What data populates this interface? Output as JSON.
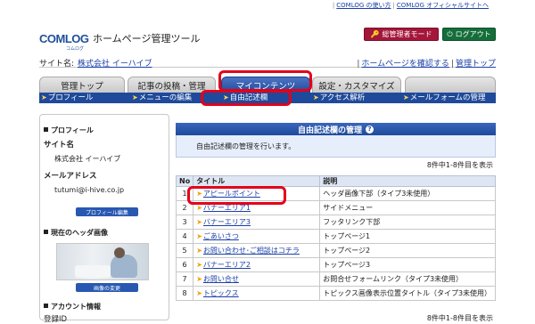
{
  "top_links": [
    "COMLOG の使い方",
    "COMLOG オフィシャルサイトへ"
  ],
  "header": {
    "logo": "COMLOG",
    "logo_sub": "コムログ",
    "title": "ホームページ管理ツール",
    "admin_button": "総管理者モード",
    "logout_button": "ログアウト"
  },
  "site_bar": {
    "label": "サイト名:",
    "site_name": "株式会社 イーハイブ",
    "confirm_link": "ホームページを確認する",
    "top_link": "管理トップ"
  },
  "tabs": [
    {
      "label": "管理トップ",
      "active": false
    },
    {
      "label": "記事の投稿・管理",
      "active": false
    },
    {
      "label": "マイコンテンツ",
      "active": true
    },
    {
      "label": "設定・カスタマイズ",
      "active": false
    }
  ],
  "subnav": [
    "プロフィール",
    "メニューの編集",
    "自由記述欄",
    "アクセス解析",
    "メールフォームの管理"
  ],
  "sidebar": {
    "profile_heading": "プロフィール",
    "site_name_label": "サイト名",
    "site_name_value": "株式会社 イーハイブ",
    "mail_label": "メールアドレス",
    "mail_value": "tutumi@i-hive.co.jp",
    "profile_edit_button": "プロフィール編集",
    "header_image_heading": "現在のヘッダ画像",
    "image_change_button": "画像の変更",
    "account_heading": "アカウント情報",
    "login_id_label": "登録ID"
  },
  "panel": {
    "title": "自由記述欄の管理",
    "description": "自由記述欄の管理を行います。",
    "count_text": "8件中1-8件目を表示",
    "columns": [
      "No",
      "タイトル",
      "説明"
    ],
    "rows": [
      {
        "no": "1",
        "title": "アピールポイント",
        "desc": "ヘッダ画像下部（タイプ3未使用）"
      },
      {
        "no": "2",
        "title": "バナーエリア1",
        "desc": "サイドメニュー"
      },
      {
        "no": "3",
        "title": "バナーエリア3",
        "desc": "フッタリンク下部"
      },
      {
        "no": "4",
        "title": "ごあいさつ",
        "desc": "トップページ1"
      },
      {
        "no": "5",
        "title": "お問い合わせ･ご相談はコチラ",
        "desc": "トップページ2"
      },
      {
        "no": "6",
        "title": "バナーエリア2",
        "desc": "トップページ3"
      },
      {
        "no": "7",
        "title": "お問い合せ",
        "desc": "お問合せフォームリンク（タイプ3未使用）"
      },
      {
        "no": "8",
        "title": "トピックス",
        "desc": "トピックス画像表示位置タイトル（タイプ3未使用）"
      }
    ]
  },
  "colors": {
    "primary_blue": "#1f4a9b",
    "highlight_red": "#e3001b",
    "admin_red": "#a4163a",
    "logout_green": "#156e3a"
  }
}
